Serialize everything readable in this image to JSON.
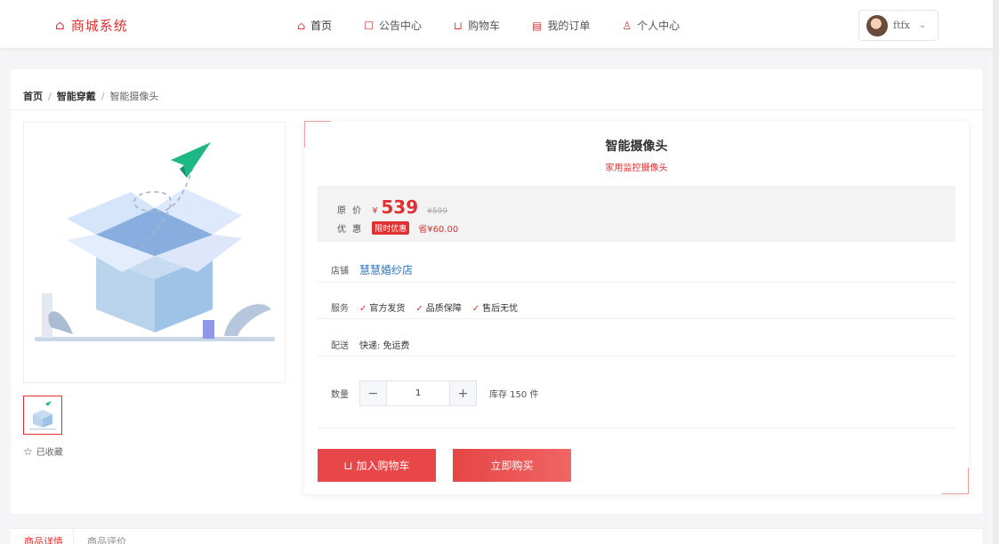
{
  "header": {
    "brand": "商城系统",
    "nav": [
      {
        "label": "首页",
        "icon": "home-icon"
      },
      {
        "label": "公告中心",
        "icon": "notice-icon"
      },
      {
        "label": "购物车",
        "icon": "cart-icon"
      },
      {
        "label": "我的订单",
        "icon": "order-icon"
      },
      {
        "label": "个人中心",
        "icon": "user-icon"
      }
    ],
    "user": {
      "name": "ftfx"
    }
  },
  "breadcrumb": {
    "home": "首页",
    "category": "智能穿戴",
    "current": "智能摄像头"
  },
  "gallery": {
    "favorite_label": "已收藏"
  },
  "product": {
    "name": "智能摄像头",
    "subtitle": "家用监控摄像头",
    "original_price_label": "原 价",
    "currency": "¥",
    "price": "539",
    "old_price": "¥599",
    "discount_label": "优 惠",
    "promo_tag": "限时优惠",
    "promo_saving": "省¥60.00",
    "shop_label": "店铺",
    "shop_name": "慧慧婚纱店",
    "service_label": "服务",
    "services": [
      "官方发货",
      "品质保障",
      "售后无忧"
    ],
    "delivery_label": "配送",
    "delivery": "快递: 免运费",
    "qty_label": "数量",
    "quantity": "1",
    "minus": "−",
    "plus": "+",
    "stock": "库存 150 件",
    "add_to_cart": "加入购物车",
    "buy_now": "立即购买"
  },
  "tabs": [
    {
      "label": "商品详情",
      "active": true
    },
    {
      "label": "商品评价",
      "active": false
    }
  ],
  "colors": {
    "accent": "#e0302f",
    "link": "#2f74c0"
  }
}
